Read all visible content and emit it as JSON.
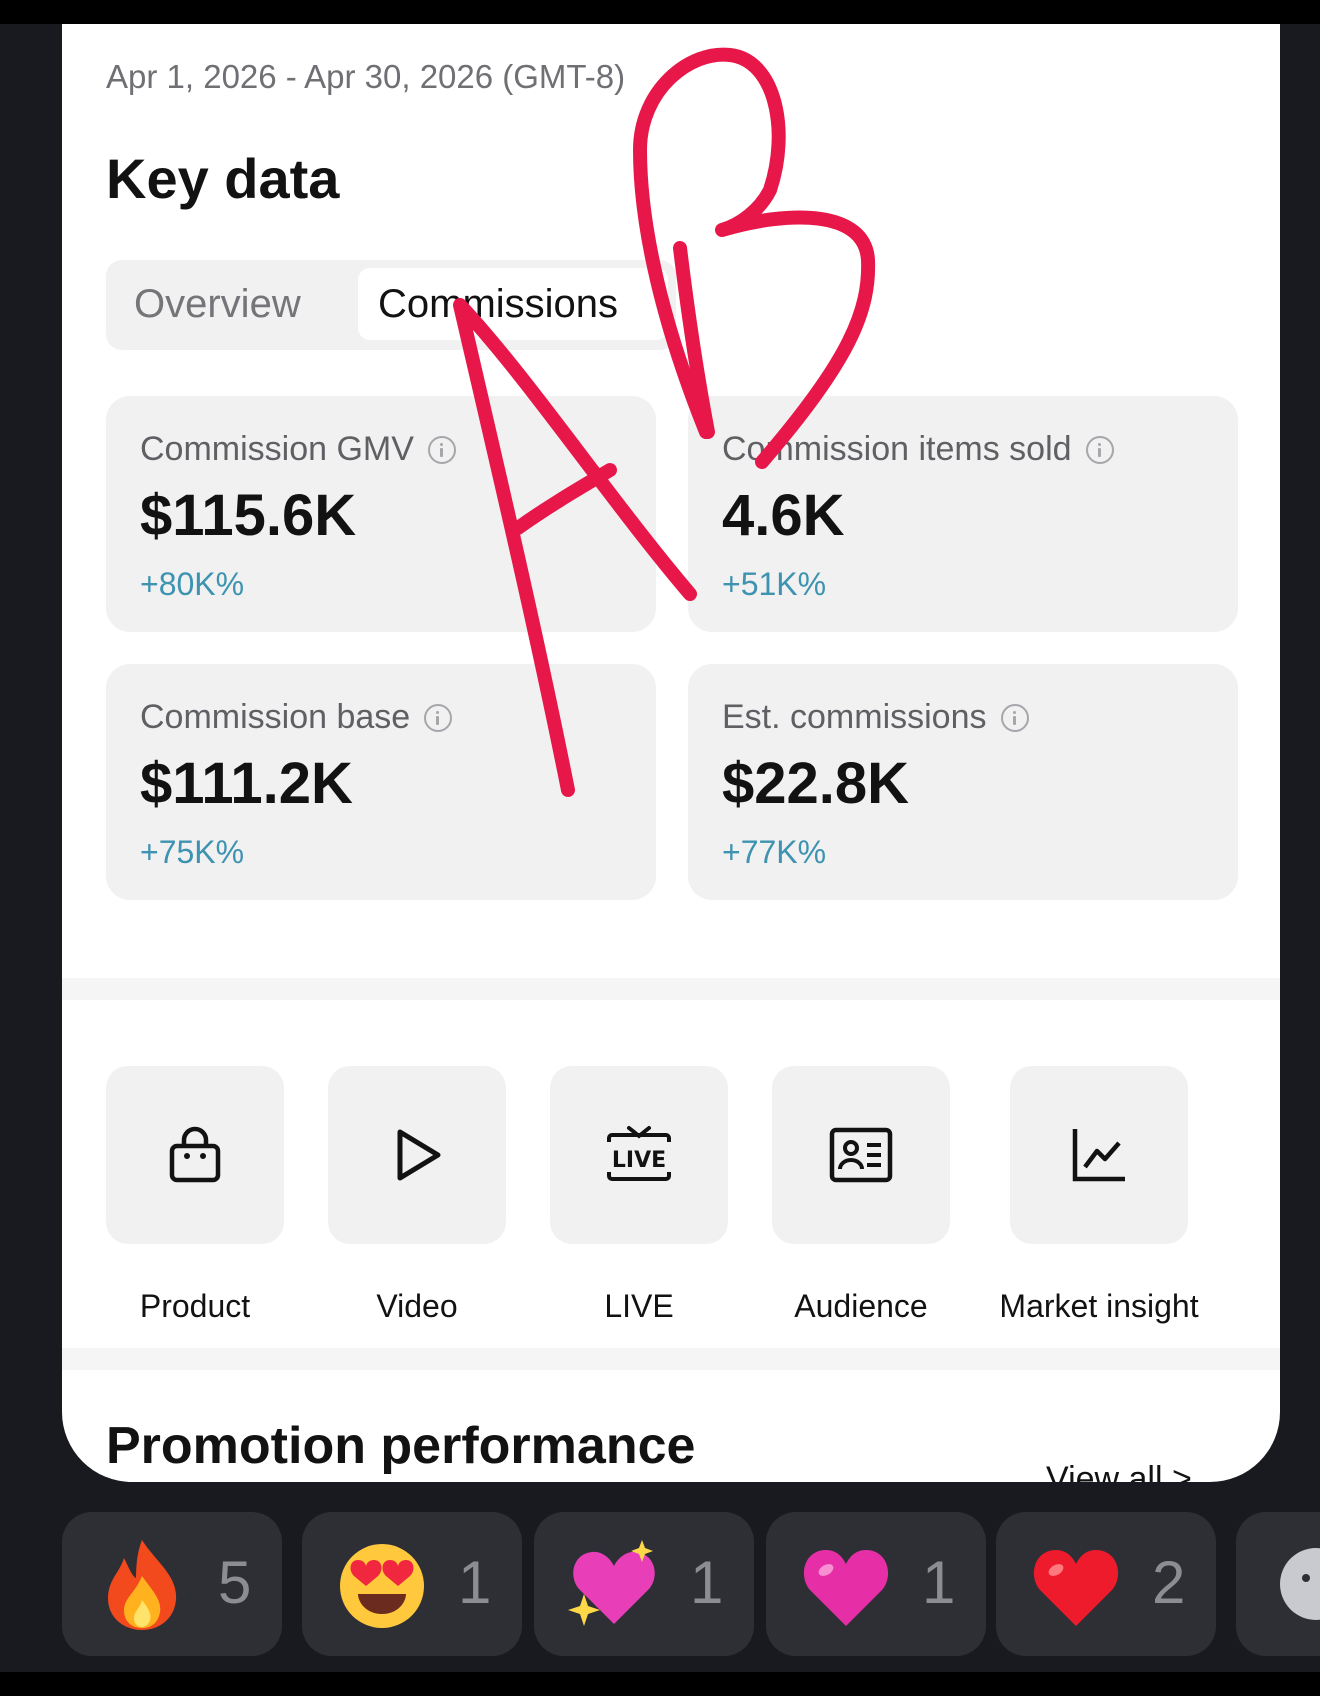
{
  "date_range": "Apr 1, 2026 - Apr 30, 2026 (GMT-8)",
  "key_data": {
    "title": "Key data",
    "tabs": [
      {
        "label": "Overview",
        "active": false
      },
      {
        "label": "Commissions",
        "active": true
      }
    ],
    "metrics": [
      {
        "label": "Commission GMV",
        "value": "$115.6K",
        "delta": "+80K%"
      },
      {
        "label": "Commission items sold",
        "value": "4.6K",
        "delta": "+51K%"
      },
      {
        "label": "Commission base",
        "value": "$111.2K",
        "delta": "+75K%"
      },
      {
        "label": "Est. commissions",
        "value": "$22.8K",
        "delta": "+77K%"
      }
    ]
  },
  "tools": [
    {
      "label": "Product",
      "icon": "shopping-bag-icon"
    },
    {
      "label": "Video",
      "icon": "play-icon"
    },
    {
      "label": "LIVE",
      "icon": "live-tv-icon"
    },
    {
      "label": "Audience",
      "icon": "id-card-icon"
    },
    {
      "label": "Market insight",
      "icon": "line-chart-icon"
    }
  ],
  "promotion": {
    "title": "Promotion performance",
    "view_all": "View all >"
  },
  "reactions": [
    {
      "emoji": "fire-icon",
      "count": "5"
    },
    {
      "emoji": "heart-eyes-face-icon",
      "count": "1"
    },
    {
      "emoji": "sparkling-heart-icon",
      "count": "1"
    },
    {
      "emoji": "pink-heart-icon",
      "count": "1"
    },
    {
      "emoji": "red-heart-icon",
      "count": "2"
    }
  ],
  "annotation": {
    "letters": "AB",
    "color": "#e8174a"
  },
  "colors": {
    "delta": "#3d93b0",
    "card": "#f1f1f2",
    "background": "#191a1f"
  }
}
